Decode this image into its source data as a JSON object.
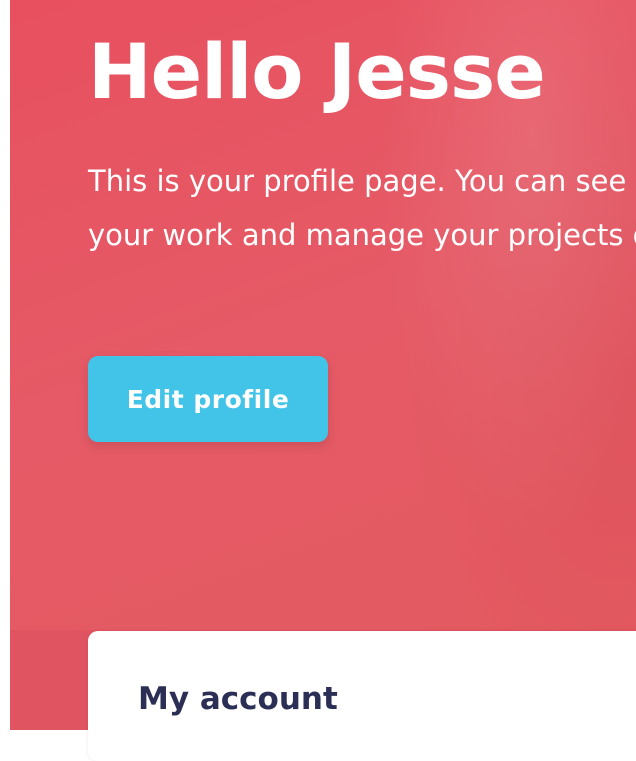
{
  "hero": {
    "greeting": "Hello Jesse",
    "intro_line_1": "This is your profile page. You can see t",
    "intro_line_2": "your work and manage your projects o",
    "edit_button_label": "Edit profile"
  },
  "account_card": {
    "title": "My account"
  },
  "colors": {
    "hero_background": "#e8505f",
    "button_background": "#42c3e8",
    "card_title": "#2c2f55"
  }
}
